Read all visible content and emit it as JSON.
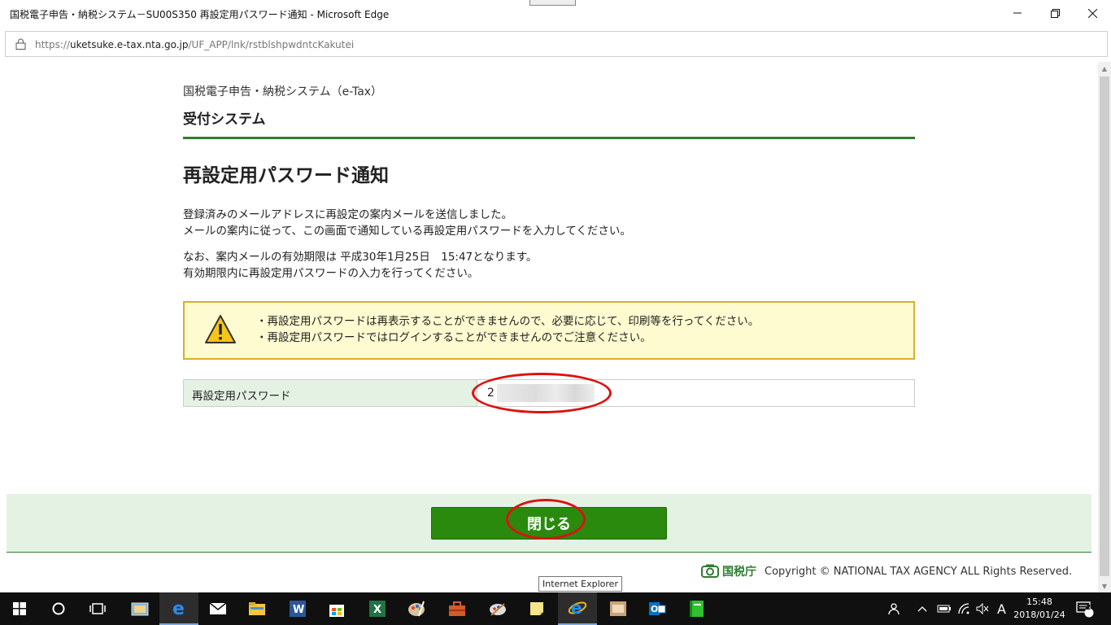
{
  "window": {
    "title": "国税電子申告・納税システム－SU00S350 再設定用パスワード通知 - Microsoft Edge",
    "minimize_icon": "minimize-icon",
    "maximize_icon": "restore-icon",
    "close_icon": "close-icon"
  },
  "address_bar": {
    "url_prefix": "https://",
    "url_host": "uketsuke.e-tax.nta.go.jp",
    "url_path": "/UF_APP/lnk/rstblshpwdntcKakutei"
  },
  "page": {
    "system_name": "国税電子申告・納税システム（e-Tax）",
    "system_sub": "受付システム",
    "title": "再設定用パスワード通知",
    "paragraph1_line1": "登録済みのメールアドレスに再設定の案内メールを送信しました。",
    "paragraph1_line2": "メールの案内に従って、この画面で通知している再設定用パスワードを入力してください。",
    "paragraph2_line1": "なお、案内メールの有効期限は 平成30年1月25日　15:47となります。",
    "paragraph2_line2": "有効期限内に再設定用パスワードの入力を行ってください。",
    "warning": {
      "line1": "・再設定用パスワードは再表示することができませんので、必要に応じて、印刷等を行ってください。",
      "line2": "・再設定用パスワードではログインすることができませんのでご注意ください。"
    },
    "password_label": "再設定用パスワード",
    "password_value_visible": "2",
    "close_button": "閉じる",
    "agency_name": "国税庁",
    "copyright": "Copyright © NATIONAL TAX AGENCY ALL Rights Reserved.",
    "tooltip": "Internet Explorer"
  },
  "taskbar": {
    "time": "15:48",
    "date": "2018/01/24",
    "notification_count": "2",
    "ime_label": "A"
  },
  "colors": {
    "brand_green": "#2e7d32",
    "button_green": "#2a8a0e",
    "warn_bg": "#fffbd0",
    "warn_border": "#d4b12e",
    "annotation_red": "#dd1111"
  }
}
